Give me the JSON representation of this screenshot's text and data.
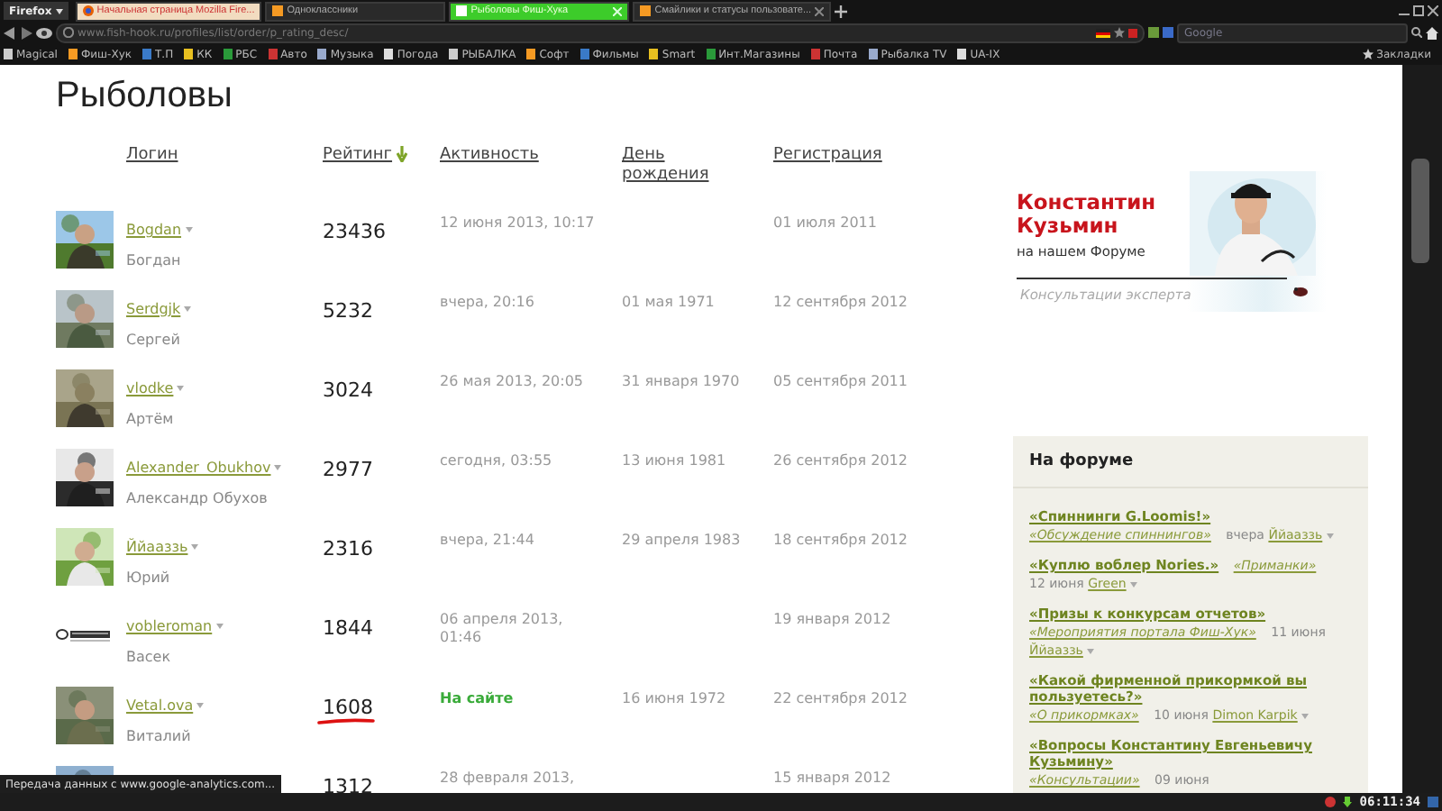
{
  "browser": {
    "menu_button": "Firefox",
    "tabs": [
      {
        "title": "Начальная страница Mozilla Fire...",
        "selected": false,
        "kind": "home"
      },
      {
        "title": "Одноклассники",
        "selected": false,
        "kind": "site"
      },
      {
        "title": "Рыболовы Фиш-Хука",
        "selected": true,
        "kind": "site"
      },
      {
        "title": "Смайлики и статусы пользовате...",
        "selected": false,
        "kind": "site"
      }
    ],
    "address": "www.fish-hook.ru/profiles/list/order/p_rating_desc/",
    "search": {
      "placeholder": "Google"
    },
    "bookmarks": [
      "Magical",
      "Фиш-Хук",
      "Т.П",
      "КК",
      "РБС",
      "Авто",
      "Музыка",
      "Погода",
      "РЫБАЛКА",
      "Софт",
      "Фильмы",
      "Smart",
      "Инт.Магазины",
      "Почта",
      "Рыбалка TV",
      "UA-IX"
    ],
    "bookmarks_menu": "Закладки"
  },
  "page": {
    "title": "Рыболовы",
    "columns": [
      {
        "label": "Логин",
        "sorted": false
      },
      {
        "label": "Рейтинг",
        "sorted": true
      },
      {
        "label": "Активность",
        "sorted": false
      },
      {
        "label": "День рождения",
        "sorted": false
      },
      {
        "label": "Регистрация",
        "sorted": false
      }
    ],
    "rows": [
      {
        "login": "Bogdan",
        "name": "Богдан",
        "rating": "23436",
        "activity": "12 июня 2013, 10:17",
        "online": false,
        "birthday": "",
        "registered": "01 июля 2011",
        "underlined": false
      },
      {
        "login": "Serdgjk",
        "name": "Сергей",
        "rating": "5232",
        "activity": "вчера, 20:16",
        "online": false,
        "birthday": "01 мая 1971",
        "registered": "12 сентября 2012",
        "underlined": false
      },
      {
        "login": "vlodke",
        "name": "Артём",
        "rating": "3024",
        "activity": "26 мая 2013, 20:05",
        "online": false,
        "birthday": "31 января 1970",
        "registered": "05 сентября 2011",
        "underlined": false
      },
      {
        "login": "Alexander_Obukhov",
        "name": "Александр Обухов",
        "rating": "2977",
        "activity": "сегодня, 03:55",
        "online": false,
        "birthday": "13 июня 1981",
        "registered": "26 сентября 2012",
        "underlined": false
      },
      {
        "login": "Ййааззь",
        "name": "Юрий",
        "rating": "2316",
        "activity": "вчера, 21:44",
        "online": false,
        "birthday": "29 апреля 1983",
        "registered": "18 сентября 2012",
        "underlined": false
      },
      {
        "kind": "logo",
        "login": "vobleroman",
        "name": "Васек",
        "rating": "1844",
        "activity": "06 апреля 2013, 01:46",
        "online": false,
        "birthday": "",
        "registered": "19 января 2012",
        "underlined": false
      },
      {
        "login": "Vetal.ova",
        "name": "Виталий",
        "rating": "1608",
        "activity": "На сайте",
        "online": true,
        "birthday": "16 июня 1972",
        "registered": "22 сентября 2012",
        "underlined": true
      },
      {
        "rating": "1312",
        "activity": "28 февраля 2013,",
        "online": false,
        "birthday": "",
        "registered": "15 января 2012",
        "underlined": false
      }
    ]
  },
  "banner": {
    "name": "Константин Кузьмин",
    "subtitle": "на нашем Форуме",
    "caption": "Консультации эксперта"
  },
  "forum": {
    "title": "На форуме",
    "items": [
      {
        "topic": "«Спиннинги G.Loomis!»",
        "section": "«Обсуждение спиннингов»",
        "date": "вчера",
        "author": "Ййааззь"
      },
      {
        "topic": "«Куплю воблер Nories.»",
        "section": "«Приманки»",
        "date": "12 июня",
        "author": "Green"
      },
      {
        "topic": "«Призы к конкурсам отчетов»",
        "section": "«Мероприятия портала Фиш-Хук»",
        "date": "11 июня",
        "author": "Ййааззь"
      },
      {
        "topic": "«Какой фирменной прикормкой вы пользуетесь?»",
        "section": "«О прикормках»",
        "date": "10 июня",
        "author": "Dimon Karpik"
      },
      {
        "topic": "«Вопросы Константину Евгеньевичу Кузьмину»",
        "section": "«Консультации»",
        "date": "09 июня"
      }
    ]
  },
  "status_text": "Передача данных с www.google-analytics.com...",
  "taskbar": {
    "clock": "06:11:34"
  }
}
